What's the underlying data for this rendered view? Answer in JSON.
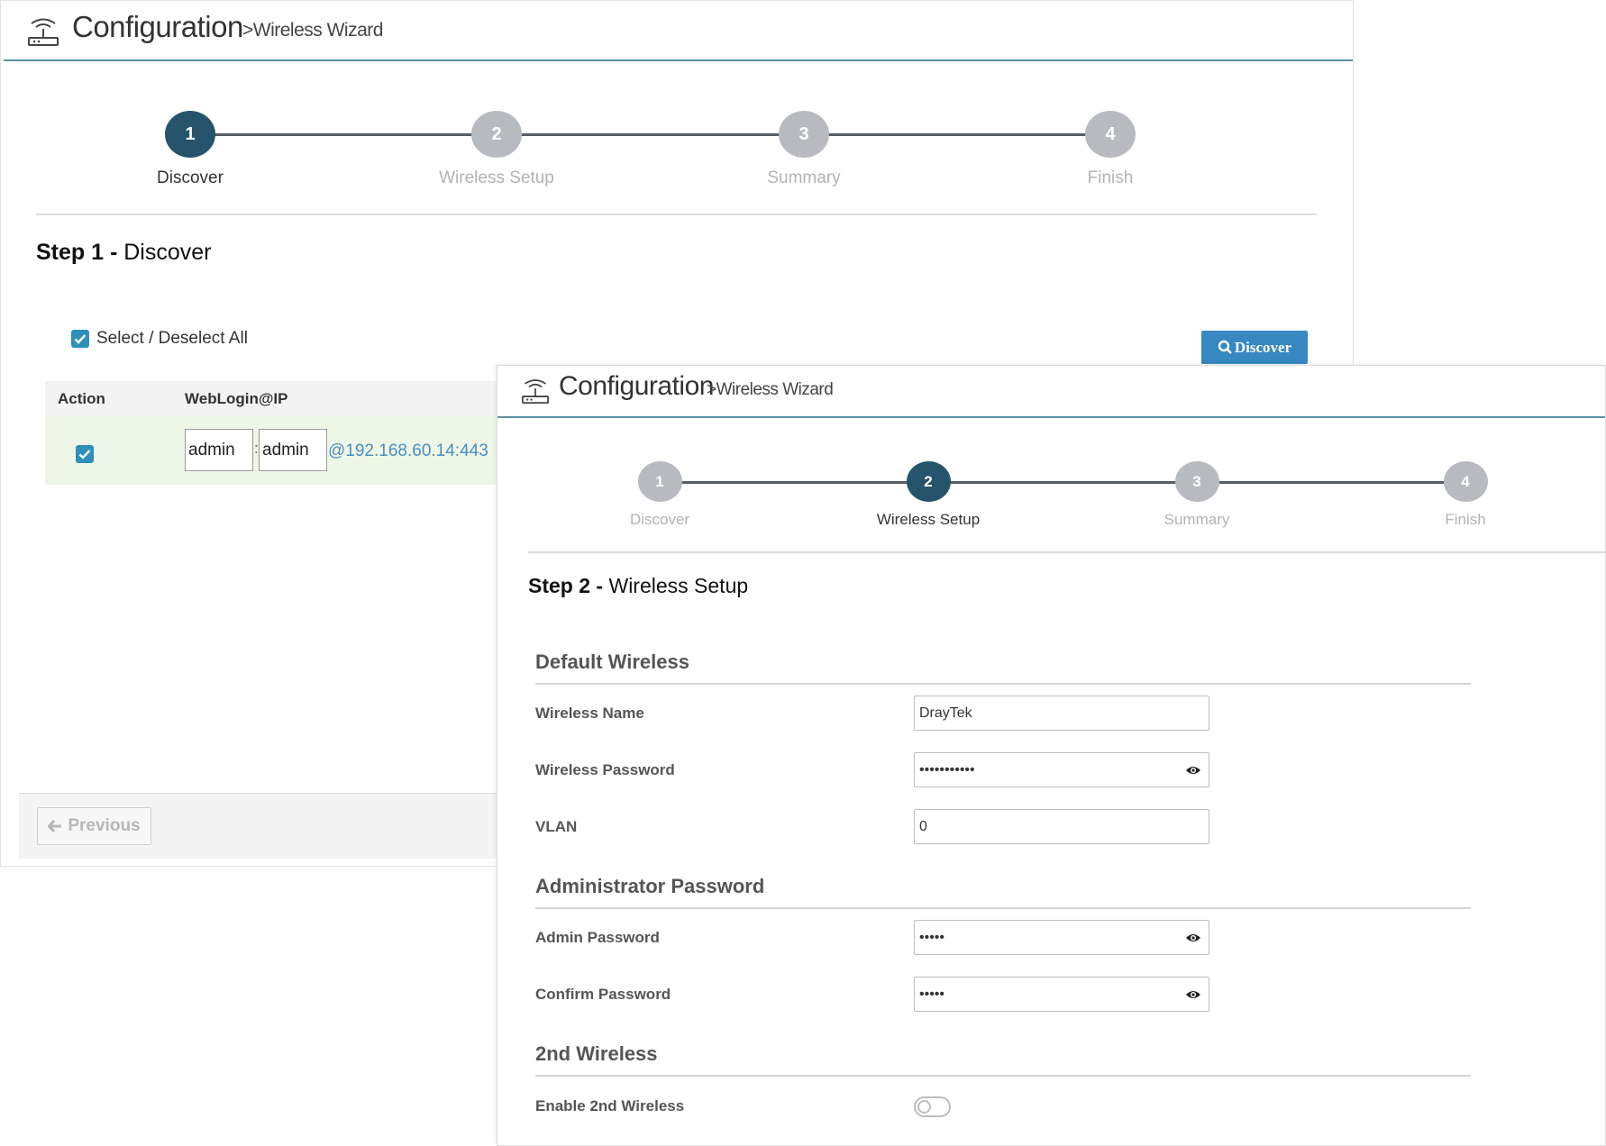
{
  "header": {
    "title": "Configuration",
    "breadcrumb": ">Wireless Wizard"
  },
  "steps": [
    {
      "number": "1",
      "label": "Discover"
    },
    {
      "number": "2",
      "label": "Wireless Setup"
    },
    {
      "number": "3",
      "label": "Summary"
    },
    {
      "number": "4",
      "label": "Finish"
    }
  ],
  "step1": {
    "active_step": 1,
    "title_prefix": "Step 1",
    "title_sep": " - ",
    "title_name": "Discover",
    "select_all_label": "Select / Deselect All",
    "select_all_checked": true,
    "discover_button": "Discover",
    "table": {
      "headers": [
        "Action",
        "WebLogin@IP"
      ],
      "rows": [
        {
          "checked": true,
          "username": "admin",
          "sep": ":",
          "password": "admin",
          "address": "@192.168.60.14:443"
        }
      ]
    },
    "previous_button": "Previous"
  },
  "step2": {
    "active_step": 2,
    "title_prefix": "Step 2",
    "title_sep": " - ",
    "title_name": "Wireless Setup",
    "sections": {
      "default_wireless": "Default Wireless",
      "admin_password": "Administrator Password",
      "second_wireless": "2nd Wireless"
    },
    "fields": {
      "wireless_name": {
        "label": "Wireless Name",
        "value": "DrayTek"
      },
      "wireless_password": {
        "label": "Wireless Password",
        "value": "•••••••••••"
      },
      "vlan": {
        "label": "VLAN",
        "value": "0"
      },
      "admin_password": {
        "label": "Admin Password",
        "value": "•••••"
      },
      "confirm_password": {
        "label": "Confirm Password",
        "value": "•••••"
      },
      "enable_2nd_wireless": {
        "label": "Enable 2nd Wireless",
        "enabled": false
      }
    }
  },
  "colors": {
    "active_step": "#25546c",
    "inactive_step": "#b7bbbf",
    "accent": "#3787c1",
    "checkbox": "#2e8fb8",
    "header_rule": "#5d8fa8",
    "ip_link": "#4a8fbf",
    "selected_row": "#eef6e8"
  },
  "icons": [
    "router-icon",
    "search-icon",
    "check-icon",
    "arrow-left-icon",
    "eye-icon"
  ]
}
